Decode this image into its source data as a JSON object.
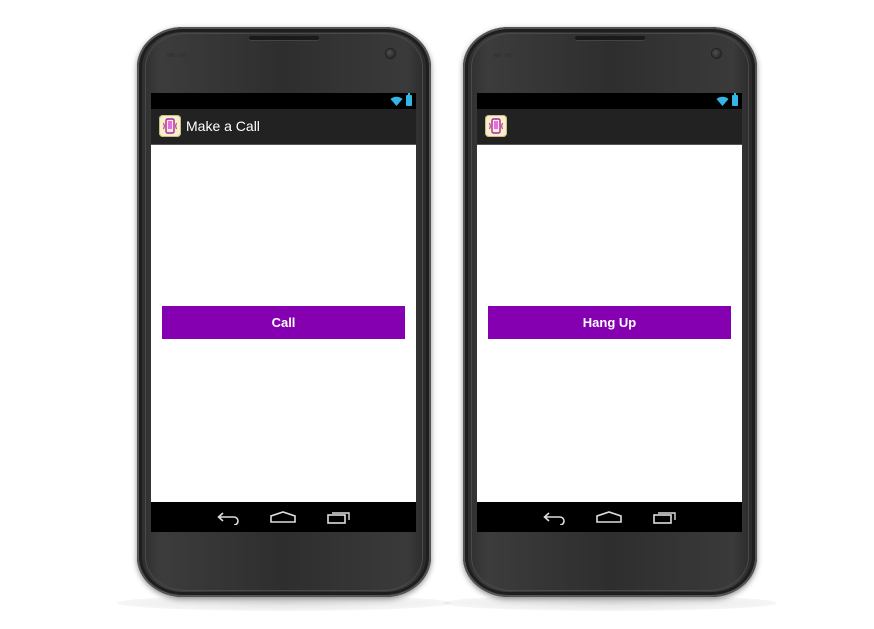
{
  "phones": [
    {
      "action_bar": {
        "title": "Make a Call",
        "app_icon": "phone-app-icon"
      },
      "button": {
        "label": "Call"
      },
      "status_bar": {
        "icons": [
          "wifi-icon",
          "battery-icon"
        ]
      },
      "nav_bar": {
        "icons": [
          "back-icon",
          "home-icon",
          "recent-apps-icon"
        ]
      }
    },
    {
      "action_bar": {
        "title": "",
        "app_icon": "phone-app-icon"
      },
      "button": {
        "label": "Hang Up"
      },
      "status_bar": {
        "icons": [
          "wifi-icon",
          "battery-icon"
        ]
      },
      "nav_bar": {
        "icons": [
          "back-icon",
          "home-icon",
          "recent-apps-icon"
        ]
      }
    }
  ],
  "colors": {
    "button": "#8400b0",
    "action_bar": "#222222",
    "status_accent": "#33b5e5",
    "screen_background": "#ffffff"
  }
}
